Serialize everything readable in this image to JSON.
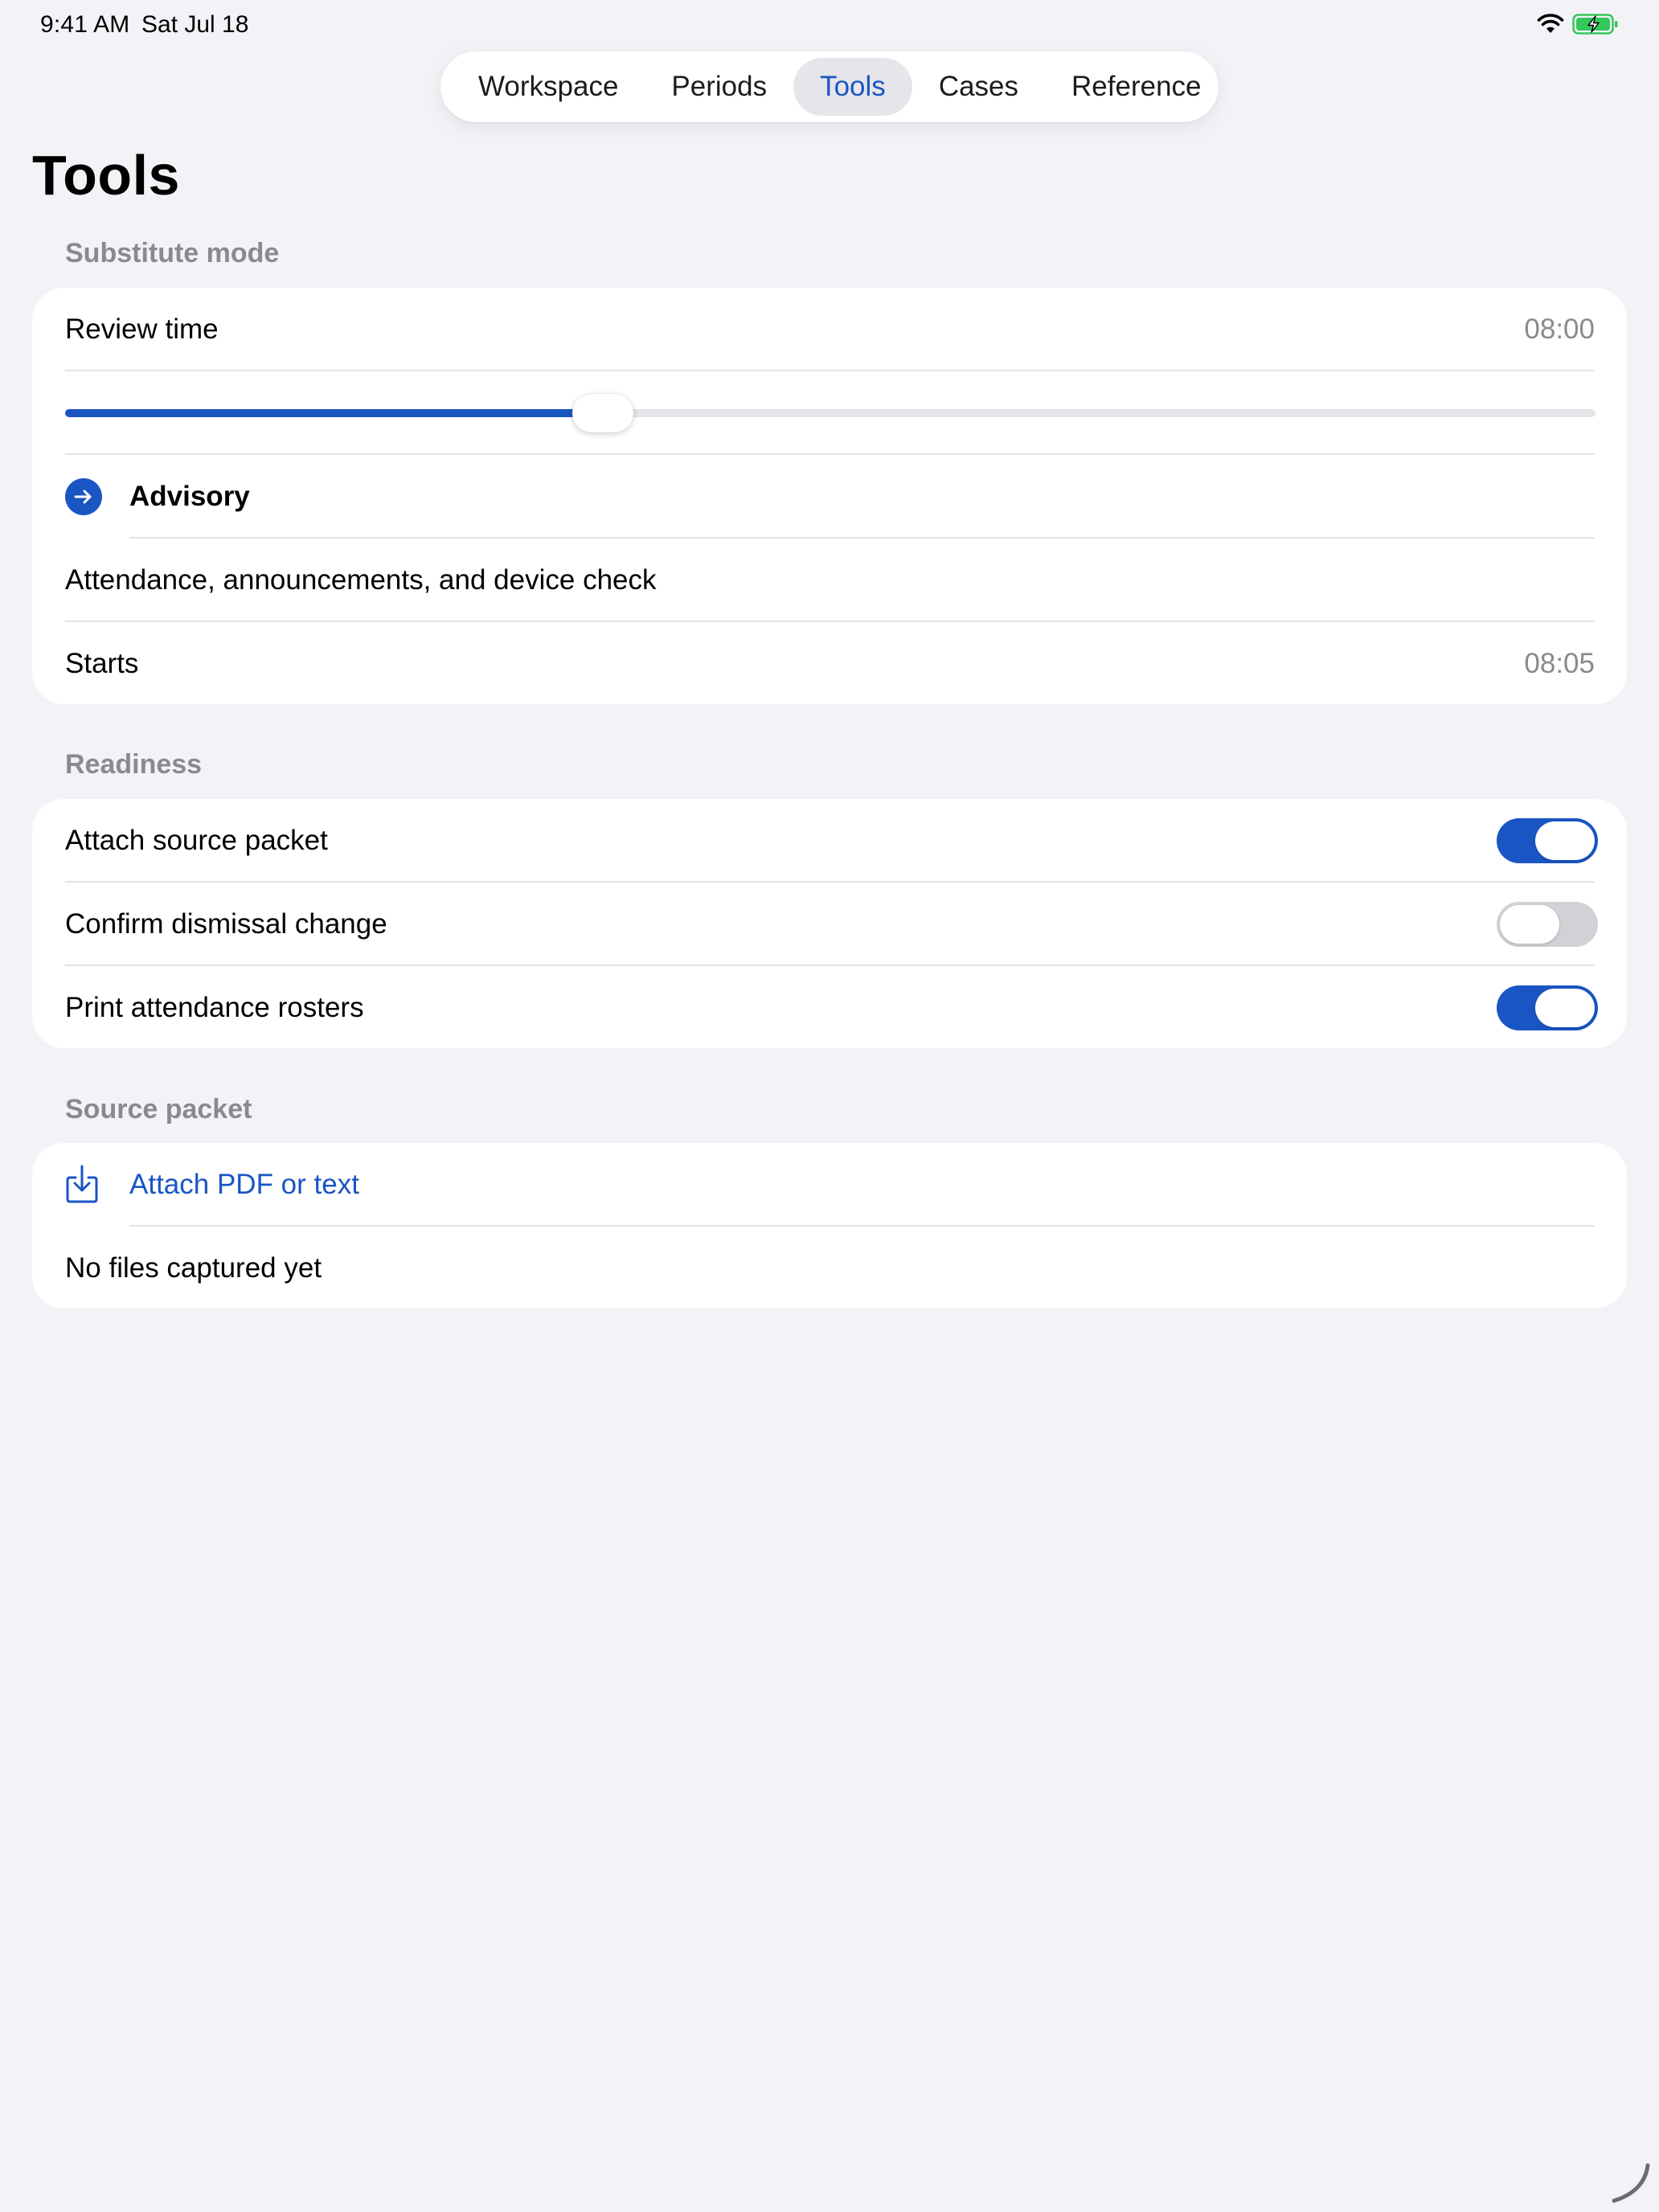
{
  "status_bar": {
    "time": "9:41 AM",
    "date": "Sat Jul 18",
    "icons": [
      "wifi-icon",
      "battery-charging-icon"
    ]
  },
  "tabs": [
    {
      "label": "Workspace",
      "active": false
    },
    {
      "label": "Periods",
      "active": false
    },
    {
      "label": "Tools",
      "active": true
    },
    {
      "label": "Cases",
      "active": false
    },
    {
      "label": "Reference",
      "active": false
    }
  ],
  "page": {
    "title": "Tools"
  },
  "substitute_mode": {
    "header": "Substitute mode",
    "review_time_label": "Review time",
    "review_time_value": "08:00",
    "slider_fraction": 0.34,
    "period_icon": "arrow-right-circle-icon",
    "period_name": "Advisory",
    "period_description": "Attendance, announcements, and device check",
    "starts_label": "Starts",
    "starts_value": "08:05"
  },
  "readiness": {
    "header": "Readiness",
    "items": [
      {
        "label": "Attach source packet",
        "on": true
      },
      {
        "label": "Confirm dismissal change",
        "on": false
      },
      {
        "label": "Print attendance rosters",
        "on": true
      }
    ]
  },
  "source_packet": {
    "header": "Source packet",
    "attach_icon": "tray-arrow-down-icon",
    "attach_label": "Attach PDF or text",
    "empty_label": "No files captured yet"
  },
  "colors": {
    "accent": "#1a55c4",
    "background": "#f2f2f7",
    "secondary_text": "#8a8a8e",
    "battery": "#34c759"
  }
}
